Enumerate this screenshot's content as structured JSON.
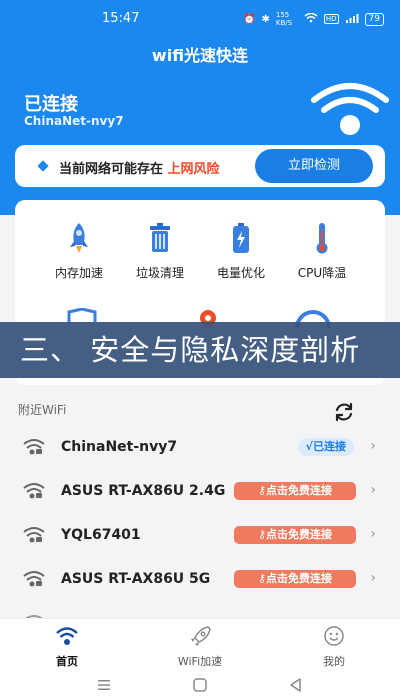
{
  "status_bar": {
    "time": "15:47",
    "speed": "155 KB/S",
    "hd": "HD",
    "battery": "79"
  },
  "app": {
    "title": "wifi光速快连"
  },
  "connection": {
    "status": "已连接",
    "ssid": "ChinaNet-nvy7"
  },
  "risk_card": {
    "text_prefix": "当前网络可能存在",
    "text_highlight": "上网风险",
    "button_label": "立即检测"
  },
  "tools": [
    {
      "label": "内存加速",
      "icon": "rocket-icon"
    },
    {
      "label": "垃圾清理",
      "icon": "trash-icon"
    },
    {
      "label": "电量优化",
      "icon": "battery-icon"
    },
    {
      "label": "CPU降温",
      "icon": "thermometer-icon"
    }
  ],
  "banner": {
    "text": "三、 安全与隐私深度剖析"
  },
  "nearby": {
    "label": "附近WiFi"
  },
  "wifi_list": [
    {
      "name": "ChinaNet-nvy7",
      "status": "√已连接",
      "type": "connected"
    },
    {
      "name": "ASUS RT-AX86U 2.4G",
      "status": "点击免费连接",
      "type": "free"
    },
    {
      "name": "YQL67401",
      "status": "点击免费连接",
      "type": "free"
    },
    {
      "name": "ASUS RT-AX86U 5G",
      "status": "点击免费连接",
      "type": "free"
    }
  ],
  "bottom_nav": [
    {
      "label": "首页",
      "icon": "wifi-icon",
      "active": true
    },
    {
      "label": "WiFi加速",
      "icon": "rocket-icon",
      "active": false
    },
    {
      "label": "我的",
      "icon": "smiley-icon",
      "active": false
    }
  ],
  "colors": {
    "primary": "#1a88ee",
    "risk": "#f04a26",
    "badge_free": "#f07a5f",
    "banner": "#37527a"
  }
}
